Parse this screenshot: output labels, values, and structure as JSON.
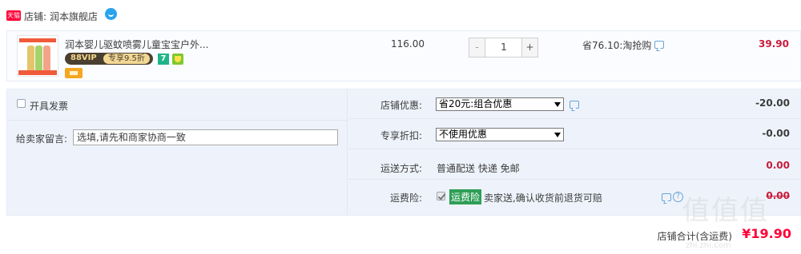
{
  "shop": {
    "badge": "天猫",
    "label": "店铺:",
    "name": "润本旗舰店"
  },
  "item": {
    "title": "润本婴儿驱蚊喷雾儿童宝宝户外...",
    "vip_label": "88VIP",
    "vip_discount": "专享9.5折",
    "seven_badge": "7",
    "unit_price": "116.00",
    "quantity": {
      "minus": "-",
      "value": "1",
      "plus": "+"
    },
    "save_text": "省76.10:淘抢购",
    "row_total": "39.90"
  },
  "invoice": {
    "label": "开具发票",
    "checked": false
  },
  "message": {
    "label": "给卖家留言:",
    "value": "选填,请先和商家协商一致"
  },
  "shop_discount": {
    "label": "店铺优惠:",
    "selected": "省20元:组合优惠",
    "amount": "-20.00"
  },
  "exclusive_discount": {
    "label": "专享折扣:",
    "selected": "不使用优惠",
    "amount": "-0.00"
  },
  "shipping": {
    "label": "运送方式:",
    "value": "普通配送 快递 免邮",
    "amount": "0.00"
  },
  "freight_insurance": {
    "label": "运费险:",
    "badge": "运费险",
    "text": "卖家送,确认收货前退货可赔",
    "amount": "0.00",
    "checked": true
  },
  "total": {
    "label": "店铺合计(含运费)",
    "amount": "¥19.90"
  },
  "watermark": {
    "text": "值值值",
    "url": "zhi.zhi.com"
  },
  "colors": {
    "price_red": "#c91b3c",
    "total_red": "#ff0036",
    "insurance_green": "#2e9e56",
    "panel_bg": "#eef3fb"
  }
}
